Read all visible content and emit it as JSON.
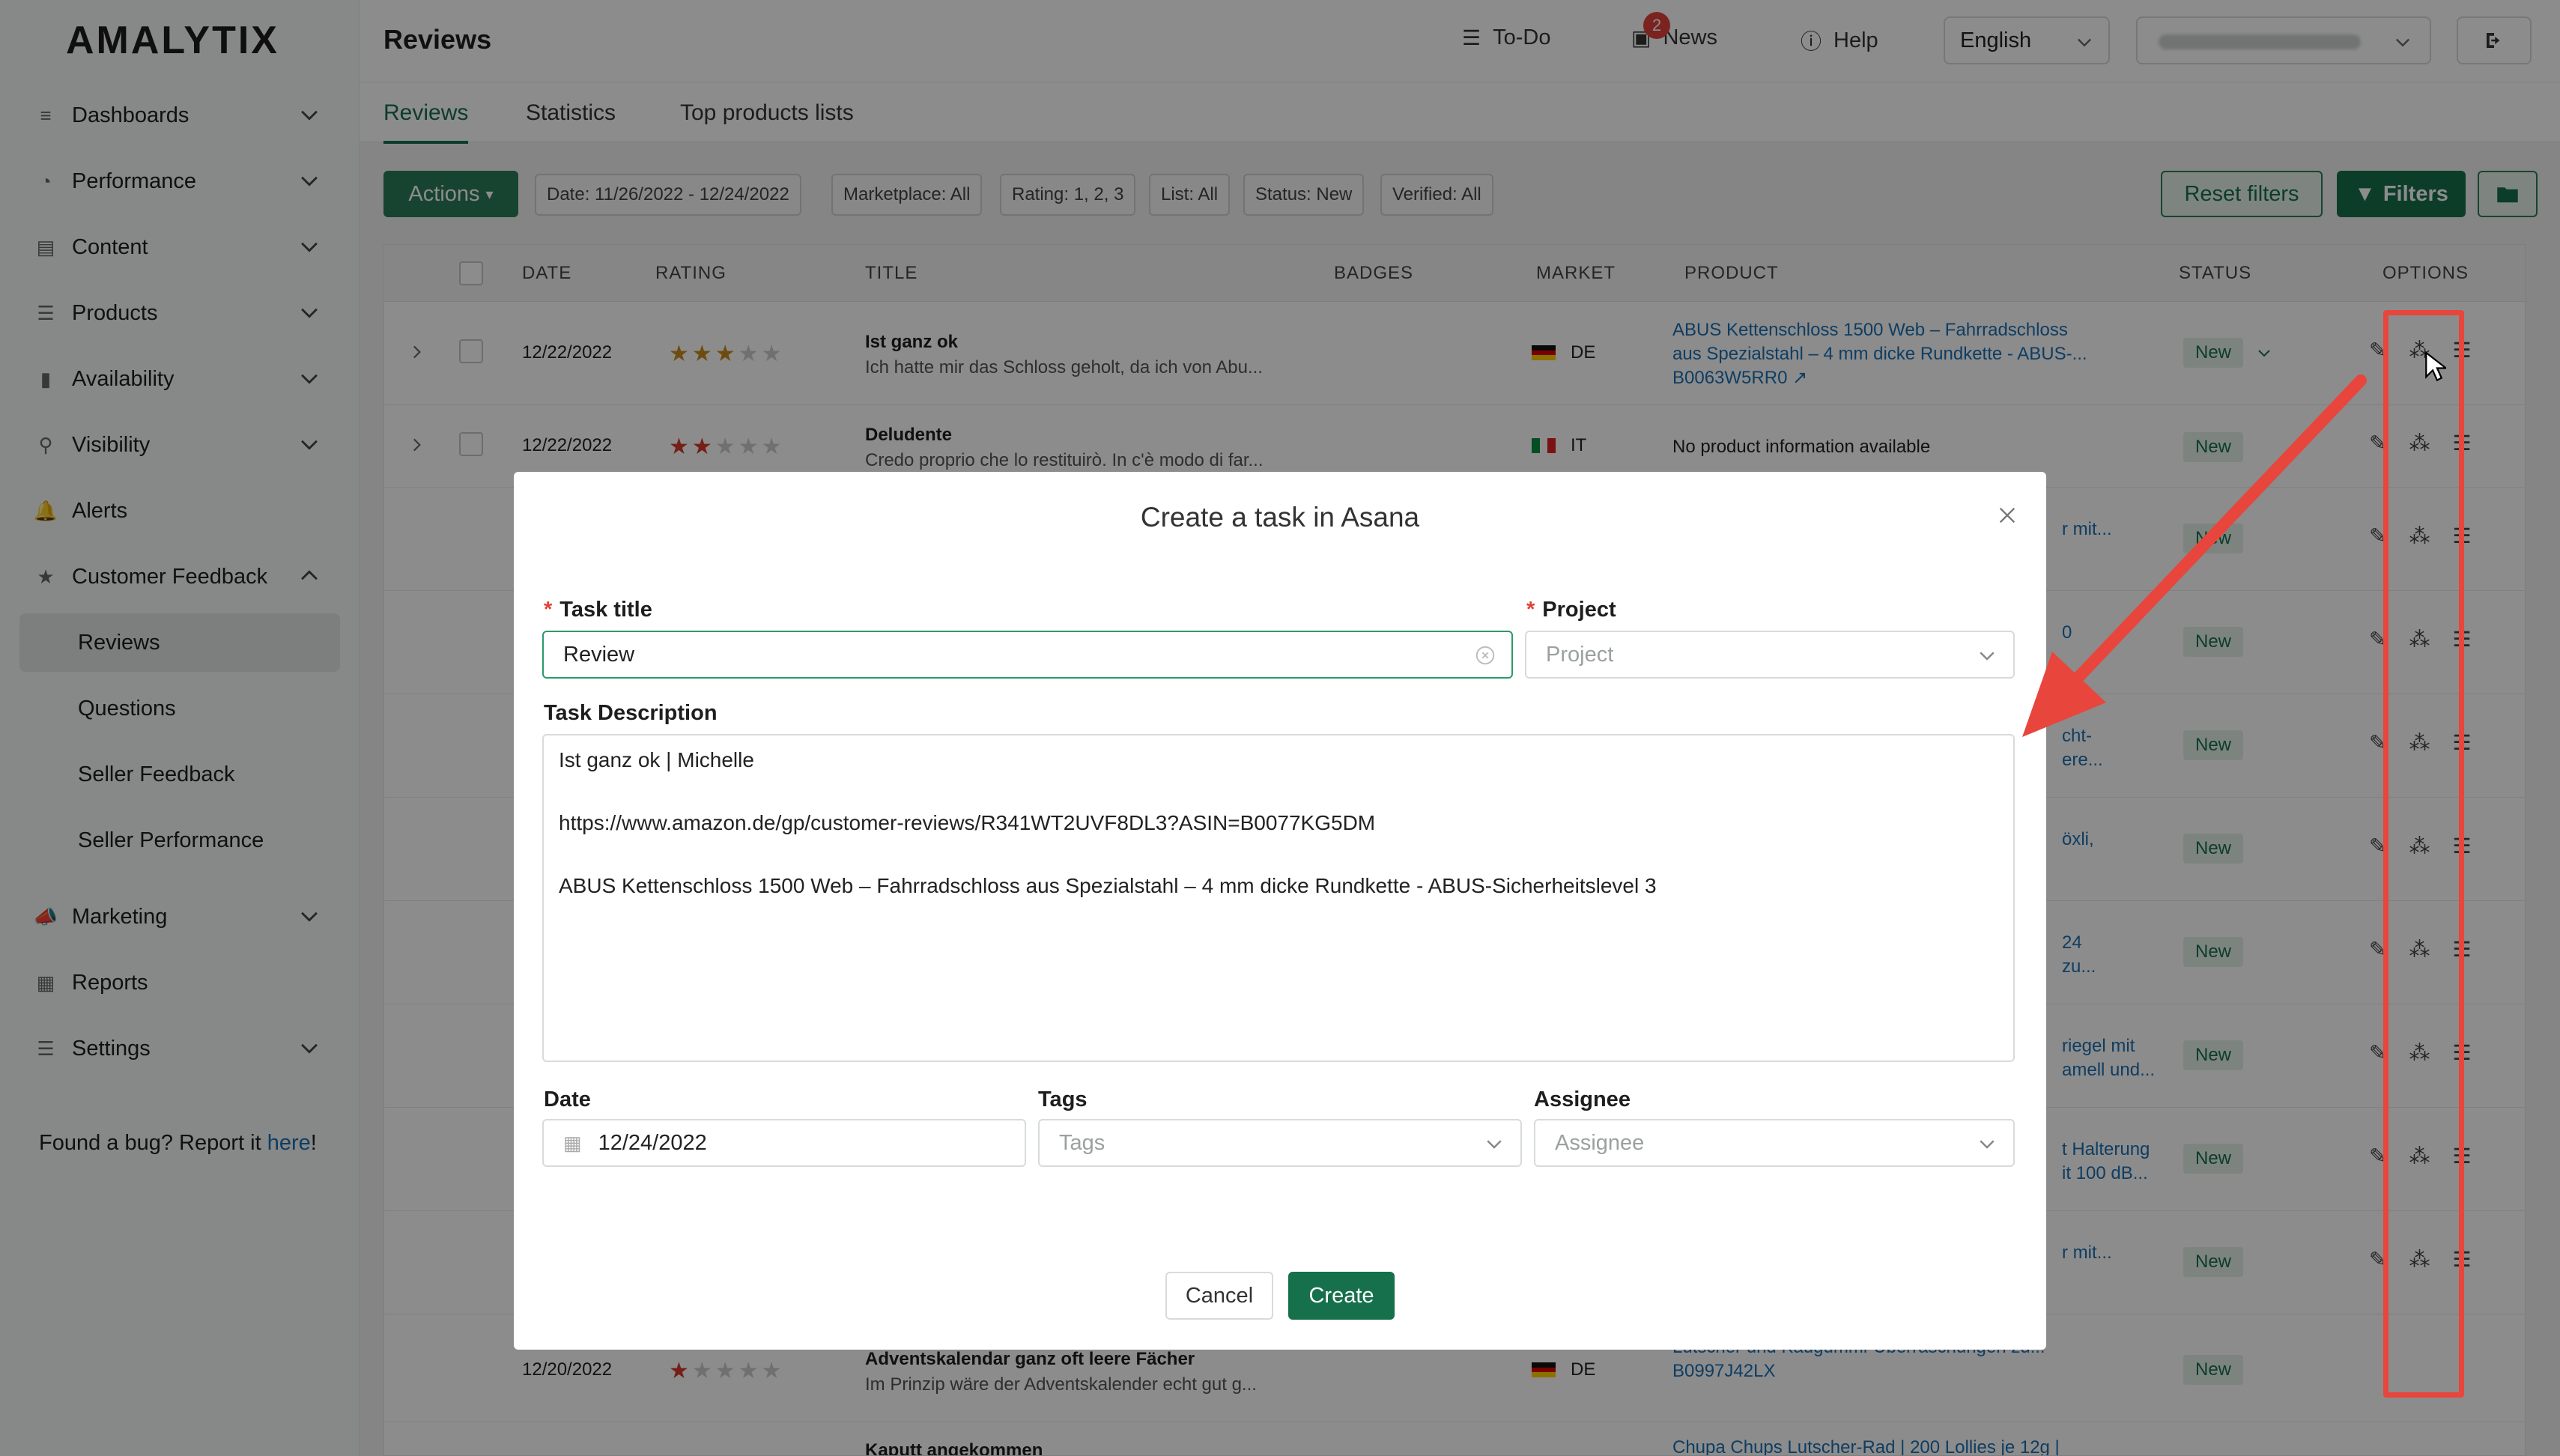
{
  "app": {
    "logo": "AMALYTIX",
    "page_title": "Reviews"
  },
  "sidebar": {
    "items": [
      {
        "label": "Dashboards",
        "icon": "dashboard-icon",
        "glyph": "≡"
      },
      {
        "label": "Performance",
        "icon": "speedometer-icon",
        "glyph": "◔"
      },
      {
        "label": "Content",
        "icon": "content-icon",
        "glyph": "▤"
      },
      {
        "label": "Products",
        "icon": "list-icon",
        "glyph": "☰"
      },
      {
        "label": "Availability",
        "icon": "battery-icon",
        "glyph": "▮"
      },
      {
        "label": "Visibility",
        "icon": "search-icon",
        "glyph": "⚲"
      },
      {
        "label": "Alerts",
        "icon": "bell-icon",
        "glyph": "🔔"
      },
      {
        "label": "Customer Feedback",
        "icon": "star-icon",
        "glyph": "★"
      },
      {
        "label": "Marketing",
        "icon": "megaphone-icon",
        "glyph": "📣"
      },
      {
        "label": "Reports",
        "icon": "table-icon",
        "glyph": "▦"
      },
      {
        "label": "Settings",
        "icon": "settings-icon",
        "glyph": "☰"
      }
    ],
    "sub_items": [
      "Reviews",
      "Questions",
      "Seller Feedback",
      "Seller Performance"
    ],
    "bug_text": "Found a bug? Report it ",
    "bug_link": "here",
    "bug_end": "!"
  },
  "topbar": {
    "todo": "To-Do",
    "news": "News",
    "news_count": "2",
    "help": "Help",
    "language": "English"
  },
  "tabs": [
    "Reviews",
    "Statistics",
    "Top products lists"
  ],
  "filters": {
    "actions": "Actions",
    "chips": [
      "Date: 11/26/2022 - 12/24/2022",
      "Marketplace: All",
      "Rating: 1, 2, 3",
      "List: All",
      "Status: New",
      "Verified: All"
    ],
    "reset": "Reset filters",
    "filters": "Filters"
  },
  "table": {
    "headers": {
      "date": "DATE",
      "rating": "RATING",
      "title": "TITLE",
      "badges": "BADGES",
      "market": "MARKET",
      "product": "PRODUCT",
      "status": "STATUS",
      "options": "OPTIONS"
    },
    "rows": [
      {
        "date": "12/22/2022",
        "rating": 3,
        "title": "Ist ganz ok",
        "excerpt": "Ich hatte mir das Schloss geholt, da ich von Abu...",
        "market": "DE",
        "product": "ABUS Kettenschloss 1500 Web – Fahrradschloss aus Spezialstahl – 4 mm dicke Rundkette - ABUS-...",
        "asin": "B0063W5RR0",
        "status": "New"
      },
      {
        "date": "12/22/2022",
        "rating": 2,
        "title": "Deludente",
        "excerpt": "Credo proprio che lo restituirò. In c'è modo di far...",
        "market": "IT",
        "product": "No product information available",
        "asin": "",
        "status": "New"
      },
      {
        "date": "12/20/2022",
        "rating": 1,
        "title": "Adventskalendar ganz oft leere Fächer",
        "excerpt": "Im Prinzip wäre der Adventskalender echt gut g...",
        "market": "DE",
        "product": "Lutscher und Kaugummi-Überraschungen zu...",
        "asin": "B0997J42LX",
        "status": "New"
      },
      {
        "date": "",
        "rating": 0,
        "title": "Kaputt angekommen",
        "excerpt": "",
        "market": "",
        "product": "Chupa Chups Lutscher-Rad | 200 Lollies je 12g |",
        "asin": "",
        "status": ""
      }
    ],
    "partial_products": [
      "r mit...",
      "0",
      "cht-\nere...",
      "öxli,",
      "24\nzu...",
      "riegel mit\namell und...",
      "t Halterung\nit 100 dB...",
      "r mit...",
      "24"
    ],
    "status_other": "New"
  },
  "modal": {
    "title": "Create a task in Asana",
    "task_title_label": "Task title",
    "task_title_value": "Review",
    "project_label": "Project",
    "project_placeholder": "Project",
    "description_label": "Task Description",
    "description_value": "Ist ganz ok | Michelle\n\nhttps://www.amazon.de/gp/customer-reviews/R341WT2UVF8DL3?ASIN=B0077KG5DM\n\nABUS Kettenschloss 1500 Web – Fahrradschloss aus Spezialstahl – 4 mm dicke Rundkette - ABUS-Sicherheitslevel 3",
    "date_label": "Date",
    "date_value": "12/24/2022",
    "tags_label": "Tags",
    "tags_placeholder": "Tags",
    "assignee_label": "Assignee",
    "assignee_placeholder": "Assignee",
    "cancel": "Cancel",
    "create": "Create"
  },
  "colors": {
    "brand": "#16704c",
    "accent_red": "#e8453c",
    "link": "#1a6fb3",
    "star": "#c88a1d"
  }
}
